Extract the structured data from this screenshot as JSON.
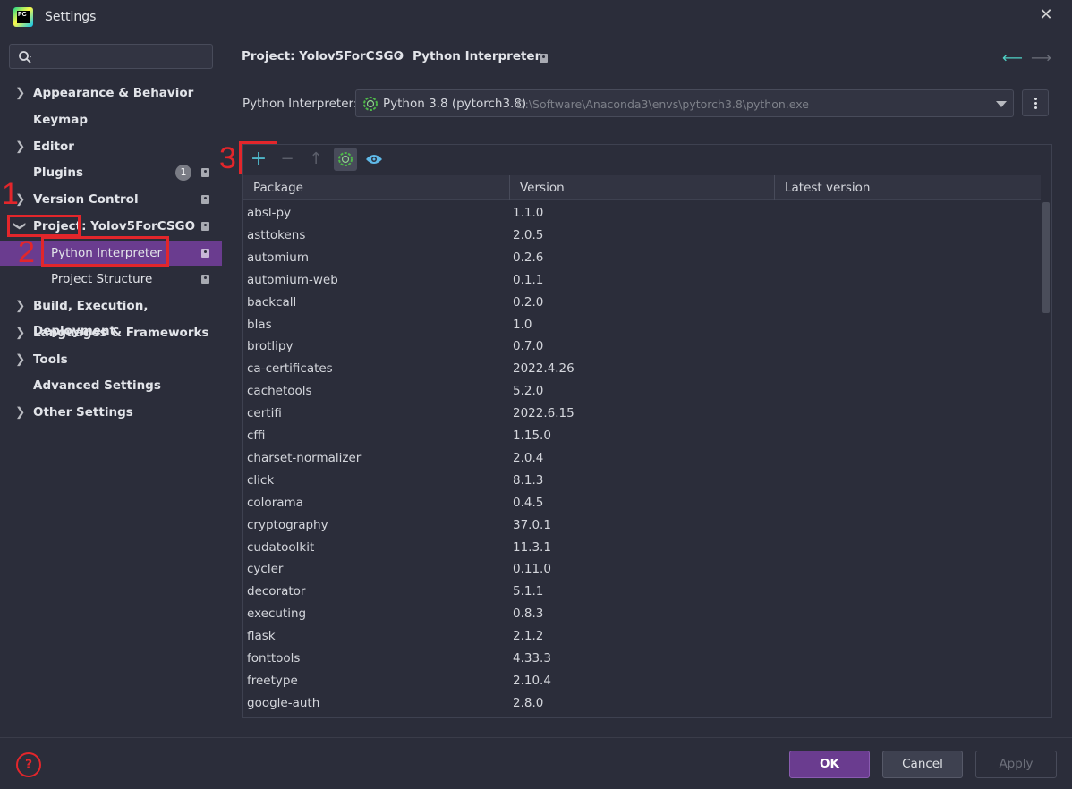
{
  "window": {
    "title": "Settings",
    "logo_text": "PC"
  },
  "sidebar": {
    "search_placeholder": "",
    "items": [
      {
        "label": "Appearance & Behavior",
        "chevron": ">"
      },
      {
        "label": "Keymap"
      },
      {
        "label": "Editor",
        "chevron": ">"
      },
      {
        "label": "Plugins",
        "badge": "1"
      },
      {
        "label": "Version Control",
        "chevron": ">"
      },
      {
        "label": "Project: Yolov5ForCSGO",
        "chevron": "v"
      },
      {
        "label": "Python Interpreter",
        "selected": true
      },
      {
        "label": "Project Structure"
      },
      {
        "label": "Build, Execution, Deployment",
        "chevron": ">"
      },
      {
        "label": "Languages & Frameworks",
        "chevron": ">"
      },
      {
        "label": "Tools",
        "chevron": ">"
      },
      {
        "label": "Advanced Settings"
      },
      {
        "label": "Other Settings",
        "chevron": ">"
      }
    ]
  },
  "annotations": {
    "one": "1",
    "two": "2",
    "three": "3"
  },
  "breadcrumb": {
    "project": "Project: Yolov5ForCSGO",
    "separator": "›",
    "page": "Python Interpreter"
  },
  "nav": {
    "back": "⟵",
    "forward": "⟶"
  },
  "interpreter": {
    "label": "Python Interpreter:",
    "name": "Python 3.8 (pytorch3.8)",
    "path": "D:\\Software\\Anaconda3\\envs\\pytorch3.8\\python.exe"
  },
  "toolbar": {
    "add": "+",
    "remove": "−",
    "upgrade": "↑"
  },
  "table": {
    "headers": [
      "Package",
      "Version",
      "Latest version"
    ],
    "rows": [
      [
        "absl-py",
        "1.1.0"
      ],
      [
        "asttokens",
        "2.0.5"
      ],
      [
        "automium",
        "0.2.6"
      ],
      [
        "automium-web",
        "0.1.1"
      ],
      [
        "backcall",
        "0.2.0"
      ],
      [
        "blas",
        "1.0"
      ],
      [
        "brotlipy",
        "0.7.0"
      ],
      [
        "ca-certificates",
        "2022.4.26"
      ],
      [
        "cachetools",
        "5.2.0"
      ],
      [
        "certifi",
        "2022.6.15"
      ],
      [
        "cffi",
        "1.15.0"
      ],
      [
        "charset-normalizer",
        "2.0.4"
      ],
      [
        "click",
        "8.1.3"
      ],
      [
        "colorama",
        "0.4.5"
      ],
      [
        "cryptography",
        "37.0.1"
      ],
      [
        "cudatoolkit",
        "11.3.1"
      ],
      [
        "cycler",
        "0.11.0"
      ],
      [
        "decorator",
        "5.1.1"
      ],
      [
        "executing",
        "0.8.3"
      ],
      [
        "flask",
        "2.1.2"
      ],
      [
        "fonttools",
        "4.33.3"
      ],
      [
        "freetype",
        "2.10.4"
      ],
      [
        "google-auth",
        "2.8.0"
      ]
    ]
  },
  "footer": {
    "help": "?",
    "ok": "OK",
    "cancel": "Cancel",
    "apply": "Apply"
  },
  "colors": {
    "accent": "#6a3c8f",
    "annotation_red": "#e3262b",
    "add_icon": "#4fb6c8",
    "eye_icon": "#5fb9e8"
  }
}
